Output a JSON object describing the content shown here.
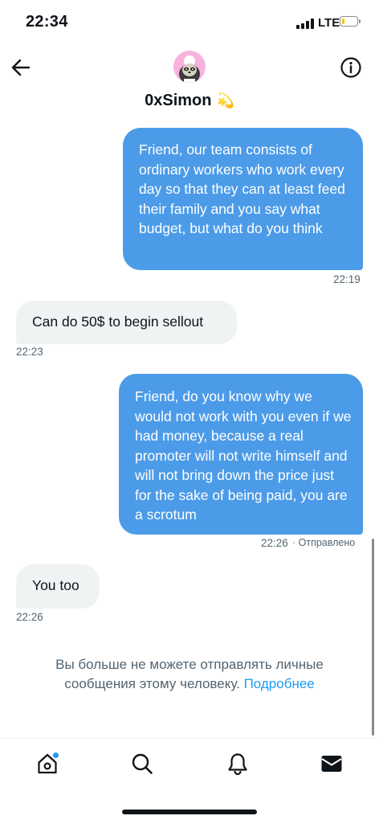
{
  "status_bar": {
    "time": "22:34",
    "network": "LTE"
  },
  "header": {
    "name": "0xSimon",
    "badge_icon": "shooting-star-icon"
  },
  "messages": [
    {
      "direction": "out",
      "text": "Friend, our team consists of ordinary workers who work every day so that they can at least feed their family and you say what budget, but what do you think",
      "time": "22:19"
    },
    {
      "direction": "in",
      "text": "Can do 50$ to begin sellout",
      "time": "22:23"
    },
    {
      "direction": "out",
      "text": "Friend, do you know why we would not work with you even if we had money, because a real promoter will not write himself and will not bring down the price just for the sake of being paid, you are a scrotum",
      "time": "22:26",
      "status": "· Отправлено"
    },
    {
      "direction": "in",
      "text": "You too",
      "time": "22:26"
    }
  ],
  "notice": {
    "text": "Вы больше не можете отправлять личные сообщения этому человеку.",
    "link": "Подробнее"
  },
  "tabbar": [
    "home-icon",
    "search-icon",
    "bell-icon",
    "mail-icon"
  ],
  "colors": {
    "accent": "#1d9bf0",
    "outgoing_bubble": "#4c9be8",
    "incoming_bubble": "#eff3f4",
    "muted_text": "#536471"
  }
}
